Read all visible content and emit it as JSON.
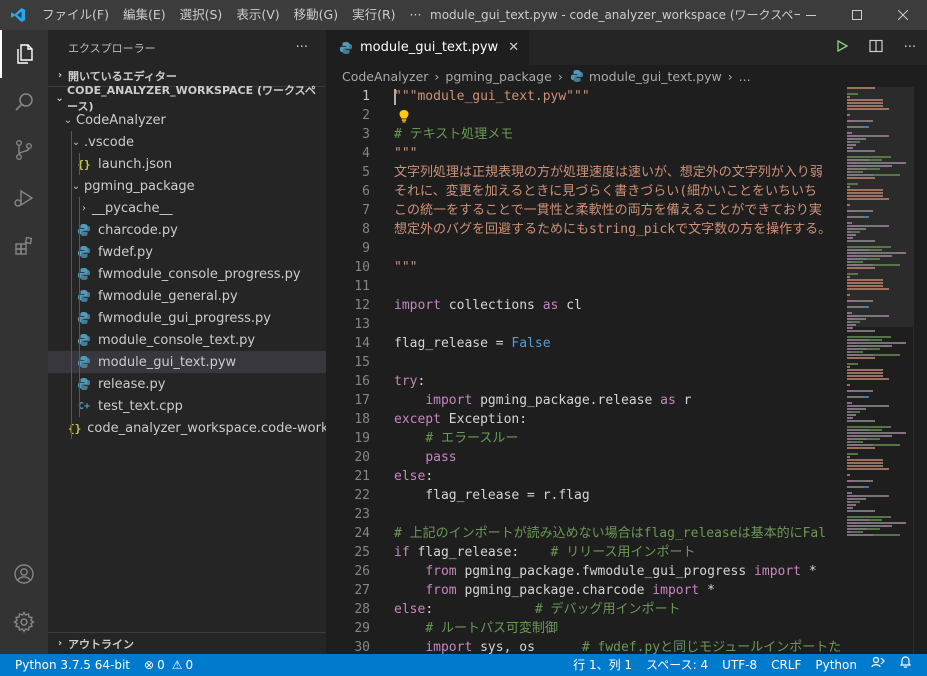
{
  "window": {
    "menu": [
      "ファイル(F)",
      "編集(E)",
      "選択(S)",
      "表示(V)",
      "移動(G)",
      "実行(R)",
      "···"
    ],
    "title": "module_gui_text.pyw - code_analyzer_workspace (ワークスペース)..."
  },
  "sidebar": {
    "header": "エクスプローラー",
    "more": "···",
    "open_editors": "開いているエディター",
    "workspace": "CODE_ANALYZER_WORKSPACE (ワークスペース)",
    "outline": "アウトライン",
    "tree": [
      {
        "label": "CodeAnalyzer",
        "depth": 1,
        "kind": "folder-open"
      },
      {
        "label": ".vscode",
        "depth": 2,
        "kind": "folder-open"
      },
      {
        "label": "launch.json",
        "depth": 3,
        "kind": "json"
      },
      {
        "label": "pgming_package",
        "depth": 2,
        "kind": "folder-open"
      },
      {
        "label": "__pycache__",
        "depth": 3,
        "kind": "folder-closed"
      },
      {
        "label": "charcode.py",
        "depth": 3,
        "kind": "py"
      },
      {
        "label": "fwdef.py",
        "depth": 3,
        "kind": "py"
      },
      {
        "label": "fwmodule_console_progress.py",
        "depth": 3,
        "kind": "py"
      },
      {
        "label": "fwmodule_general.py",
        "depth": 3,
        "kind": "py"
      },
      {
        "label": "fwmodule_gui_progress.py",
        "depth": 3,
        "kind": "py"
      },
      {
        "label": "module_console_text.py",
        "depth": 3,
        "kind": "py"
      },
      {
        "label": "module_gui_text.pyw",
        "depth": 3,
        "kind": "py",
        "selected": true
      },
      {
        "label": "release.py",
        "depth": 3,
        "kind": "py"
      },
      {
        "label": "test_text.cpp",
        "depth": 3,
        "kind": "cpp"
      },
      {
        "label": "code_analyzer_workspace.code-workspace",
        "depth": 2,
        "kind": "json"
      }
    ]
  },
  "editor": {
    "tab_label": "module_gui_text.pyw",
    "breadcrumb": [
      "CodeAnalyzer",
      "pgming_package",
      "module_gui_text.pyw",
      "..."
    ],
    "lines": [
      [
        [
          "str",
          "\"\"\"module_gui_text.pyw\"\"\""
        ]
      ],
      [],
      [
        [
          "com",
          "# テキスト処理メモ"
        ]
      ],
      [
        [
          "str",
          "\"\"\""
        ]
      ],
      [
        [
          "str",
          "文字列処理は正規表現の方が処理速度は速いが、想定外の文字列が入り弱"
        ]
      ],
      [
        [
          "str",
          "それに、変更を加えるときに見づらく書きづらい(細かいことをいちいち"
        ]
      ],
      [
        [
          "str",
          "この統一をすることで一貫性と柔軟性の両方を備えることができており実"
        ]
      ],
      [
        [
          "str",
          "想定外のバグを回避するためにもstring_pickで文字数の方を操作する。"
        ]
      ],
      [],
      [
        [
          "str",
          "\"\"\""
        ]
      ],
      [],
      [
        [
          "kw2",
          "import"
        ],
        [
          "txt",
          " collections "
        ],
        [
          "kw2",
          "as"
        ],
        [
          "txt",
          " cl"
        ]
      ],
      [],
      [
        [
          "txt",
          "flag_release = "
        ],
        [
          "kw",
          "False"
        ]
      ],
      [],
      [
        [
          "kw2",
          "try"
        ],
        [
          "txt",
          ":"
        ]
      ],
      [
        [
          "txt",
          "    "
        ],
        [
          "kw2",
          "import"
        ],
        [
          "txt",
          " pgming_package.release "
        ],
        [
          "kw2",
          "as"
        ],
        [
          "txt",
          " r"
        ]
      ],
      [
        [
          "kw2",
          "except"
        ],
        [
          "txt",
          " Exception:"
        ]
      ],
      [
        [
          "txt",
          "    "
        ],
        [
          "com",
          "# エラースルー"
        ]
      ],
      [
        [
          "txt",
          "    "
        ],
        [
          "kw2",
          "pass"
        ]
      ],
      [
        [
          "kw2",
          "else"
        ],
        [
          "txt",
          ":"
        ]
      ],
      [
        [
          "txt",
          "    flag_release = r.flag"
        ]
      ],
      [],
      [
        [
          "com",
          "# 上記のインポートが読み込めない場合はflag_releaseは基本的にFal"
        ]
      ],
      [
        [
          "kw2",
          "if"
        ],
        [
          "txt",
          " flag_release:    "
        ],
        [
          "com",
          "# リリース用インポート"
        ]
      ],
      [
        [
          "txt",
          "    "
        ],
        [
          "kw2",
          "from"
        ],
        [
          "txt",
          " pgming_package.fwmodule_gui_progress "
        ],
        [
          "kw2",
          "import"
        ],
        [
          "txt",
          " *"
        ]
      ],
      [
        [
          "txt",
          "    "
        ],
        [
          "kw2",
          "from"
        ],
        [
          "txt",
          " pgming_package.charcode "
        ],
        [
          "kw2",
          "import"
        ],
        [
          "txt",
          " *"
        ]
      ],
      [
        [
          "kw2",
          "else"
        ],
        [
          "txt",
          ":             "
        ],
        [
          "com",
          "# デバッグ用インポート"
        ]
      ],
      [
        [
          "txt",
          "    "
        ],
        [
          "com",
          "# ルートパス可変制御"
        ]
      ],
      [
        [
          "txt",
          "    "
        ],
        [
          "kw2",
          "import"
        ],
        [
          "txt",
          " sys, os      "
        ],
        [
          "com",
          "# fwdef.pyと同じモジュールインポートた"
        ]
      ]
    ]
  },
  "status": {
    "python": "Python 3.7.5 64-bit",
    "errors": "0",
    "warnings": "0",
    "position": "行 1、列 1",
    "spaces": "スペース: 4",
    "encoding": "UTF-8",
    "eol": "CRLF",
    "language": "Python"
  },
  "colors": {
    "accent": "#007acc",
    "titlebar": "#3c3c3c",
    "activitybar": "#333333",
    "sidebar": "#252526",
    "editor": "#1e1e1e"
  }
}
